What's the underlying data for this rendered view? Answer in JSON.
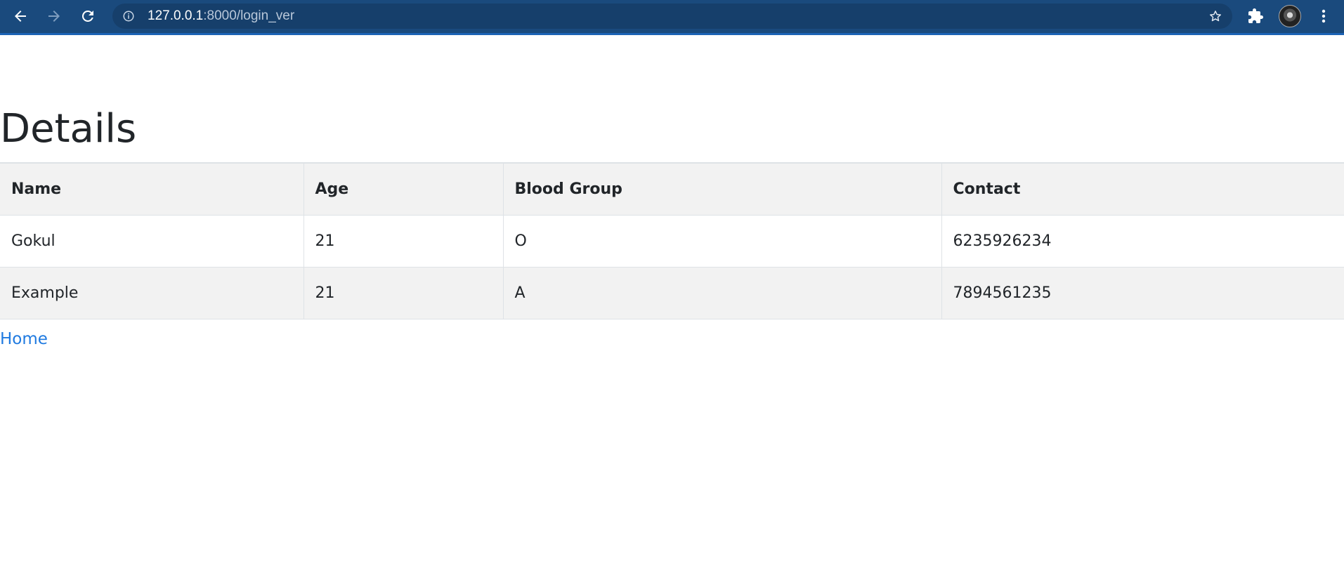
{
  "browser": {
    "url_host": "127.0.0.1",
    "url_path": ":8000/login_ver",
    "icons": [
      "back-arrow-icon",
      "forward-arrow-icon",
      "reload-icon",
      "info-icon",
      "star-icon",
      "puzzle-icon",
      "avatar",
      "more-vert-icon"
    ],
    "theme_color": "#1a4a7d"
  },
  "page": {
    "title": "Details",
    "table": {
      "headers": [
        "Name",
        "Age",
        "Blood Group",
        "Contact"
      ],
      "rows": [
        [
          "Gokul",
          "21",
          "O",
          "6235926234"
        ],
        [
          "Example",
          "21",
          "A",
          "7894561235"
        ]
      ]
    },
    "home_link": "Home",
    "link_color": "#1f7ae0"
  }
}
